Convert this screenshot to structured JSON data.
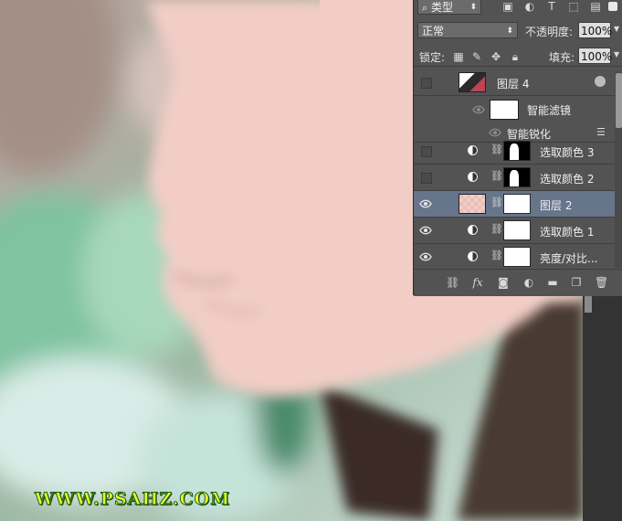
{
  "panel": {
    "filter_label": "类型",
    "blend_mode": "正常",
    "opacity_label": "不透明度:",
    "opacity_value": "100%",
    "lock_label": "锁定:",
    "fill_label": "填充:",
    "fill_value": "100%"
  },
  "layers": [
    {
      "name": "图层 4",
      "type": "smart-object",
      "visible": false
    },
    {
      "name": "智能滤镜",
      "type": "smart-filter-group",
      "visible": true
    },
    {
      "name": "智能锐化",
      "type": "smart-filter",
      "visible": true
    },
    {
      "name": "选取颜色 3",
      "type": "adjustment",
      "visible": false
    },
    {
      "name": "选取颜色 2",
      "type": "adjustment",
      "visible": false
    },
    {
      "name": "图层 2",
      "type": "pixel",
      "visible": true,
      "selected": true
    },
    {
      "name": "选取颜色 1",
      "type": "adjustment",
      "visible": true
    },
    {
      "name": "亮度/对比...",
      "type": "adjustment",
      "visible": true
    }
  ],
  "watermark": "WWW.PSAHZ.COM",
  "colors": {
    "panel_bg": "#535353",
    "selected_row": "#67758b",
    "skin": "#f1cdc6",
    "watermark": "#e8ff2a"
  }
}
